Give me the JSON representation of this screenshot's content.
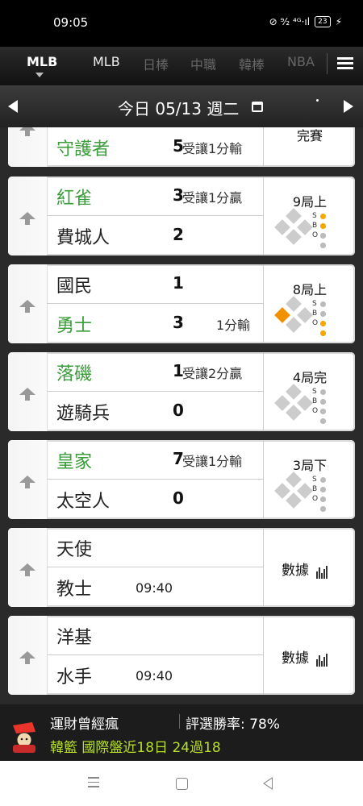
{
  "status": {
    "time": "09:05",
    "indicators": "⊘ ⁹⁄₂ ⁴ᴳ·ıl",
    "battery": "23"
  },
  "tabs": [
    {
      "label": "MLB",
      "active": true
    },
    {
      "label": "MLB"
    },
    {
      "label": "日棒"
    },
    {
      "label": "中職"
    },
    {
      "label": "韓棒"
    },
    {
      "label": "NBA"
    }
  ],
  "date": {
    "label": "今日 05/13 週二"
  },
  "games": [
    {
      "team1": "守護者",
      "score1": "5",
      "line": "受讓1分輸",
      "status": "完賽"
    },
    {
      "team1": "紅雀",
      "team1_green": true,
      "score1": "3",
      "odds1": "受讓1分贏",
      "team2": "費城人",
      "score2": "2",
      "inning": "9局上",
      "bases": "none",
      "strikes": 2,
      "balls": 3,
      "outs": 0
    },
    {
      "team1": "國民",
      "score1": "1",
      "team2": "勇士",
      "team2_green": true,
      "score2": "3",
      "odds2": "1分輸",
      "inning": "8局上",
      "bases": "first",
      "strikes": 0,
      "balls": 0,
      "outs": 2
    },
    {
      "team1": "落磯",
      "team1_green": true,
      "score1": "1",
      "odds1": "受讓2分贏",
      "team2": "遊騎兵",
      "score2": "0",
      "inning": "4局完",
      "bases": "none",
      "strikes": 0,
      "balls": 0,
      "outs": 0
    },
    {
      "team1": "皇家",
      "team1_green": true,
      "score1": "7",
      "odds1": "受讓1分輸",
      "team2": "太空人",
      "score2": "0",
      "inning": "3局下",
      "bases": "none",
      "strikes": 0,
      "balls": 0,
      "outs": 0
    },
    {
      "team1": "天使",
      "team2": "教士",
      "time": "09:40",
      "stats_label": "數據"
    },
    {
      "team1": "洋基",
      "team2": "水手",
      "time": "09:40",
      "stats_label": "數據"
    }
  ],
  "footer": {
    "name": "運財曾經瘋",
    "rate": "評選勝率: 78%",
    "record": "韓籃 國際盤近18日 24過18"
  }
}
